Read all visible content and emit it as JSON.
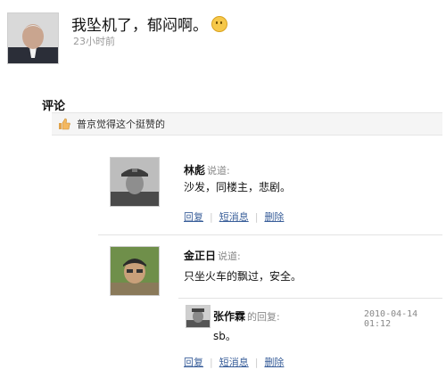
{
  "status": {
    "text": "我坠机了，郁闷啊。",
    "time": "23小时前",
    "emoji_icon": "sad-face-icon"
  },
  "comments_section": {
    "title": "评论",
    "like_text": "普京觉得这个挺赞的",
    "like_icon": "thumbs-up-icon"
  },
  "comments": [
    {
      "author": "林彪",
      "said_label": "说道:",
      "body": "沙发，同楼主，悲剧。",
      "actions": [
        "回复",
        "短消息",
        "删除"
      ]
    },
    {
      "author": "金正日",
      "said_label": "说道:",
      "body": "只坐火车的飘过，安全。",
      "reply": {
        "author": "张作霖",
        "tail": "的回复:",
        "time": "2010-04-14 01:12",
        "body": "sb。"
      },
      "actions": [
        "回复",
        "短消息",
        "删除"
      ]
    }
  ],
  "colors": {
    "link": "#3a5f9a",
    "muted": "#888888",
    "like_bar_bg": "#f5f5f5"
  }
}
